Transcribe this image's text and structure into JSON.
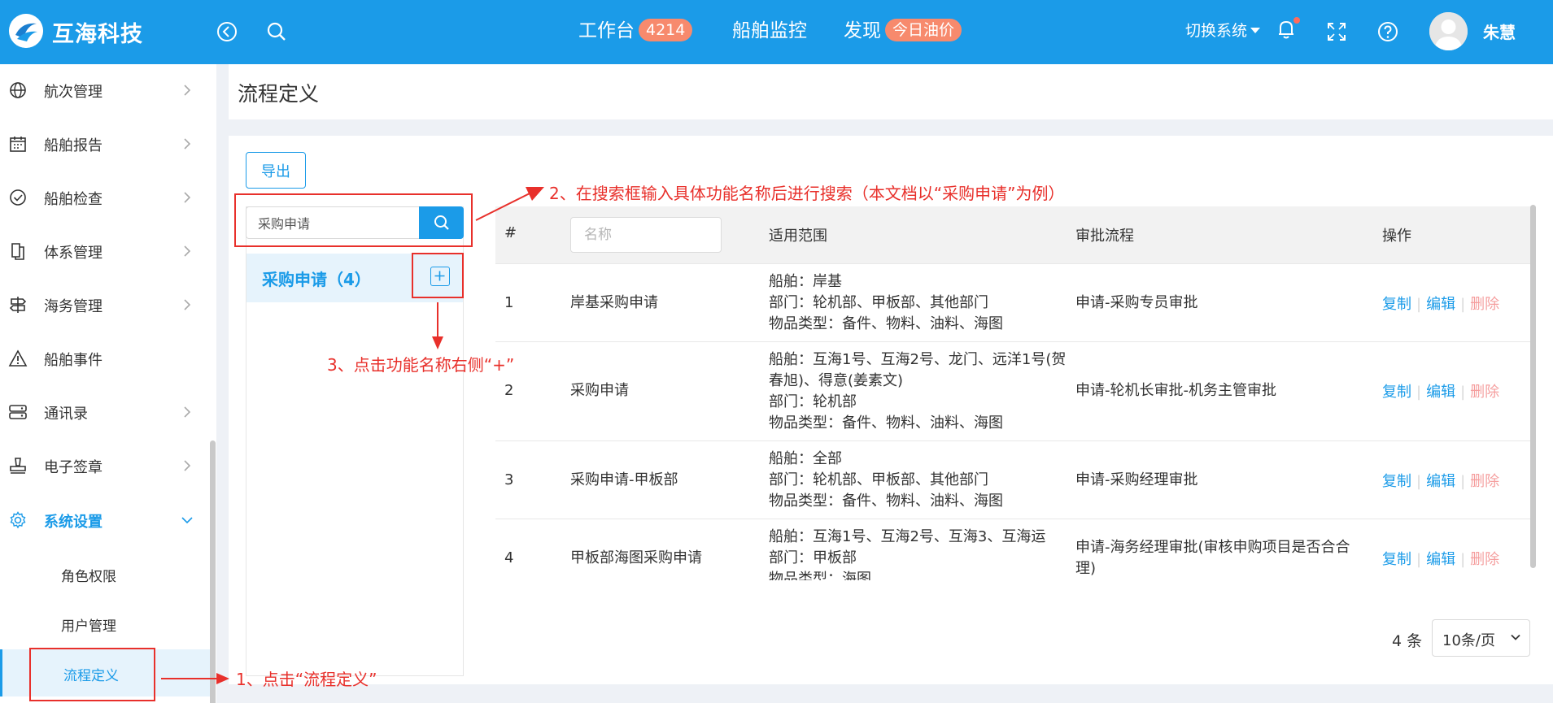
{
  "header": {
    "logo_text": "互海科技",
    "nav": [
      {
        "label": "工作台",
        "badge": "4214"
      },
      {
        "label": "船舶监控"
      },
      {
        "label": "发现",
        "badge": "今日油价"
      }
    ],
    "switch_system": "切换系统",
    "username": "朱慧",
    "colors": {
      "primary": "#1b9be8",
      "badge": "#f78a6d",
      "annotation": "#e8302b"
    }
  },
  "sidebar": {
    "items": [
      {
        "label": "航次管理",
        "icon": "globe-icon"
      },
      {
        "label": "船舶报告",
        "icon": "calendar-icon"
      },
      {
        "label": "船舶检查",
        "icon": "check-circle-icon"
      },
      {
        "label": "体系管理",
        "icon": "document-icon"
      },
      {
        "label": "海务管理",
        "icon": "signpost-icon"
      },
      {
        "label": "船舶事件",
        "icon": "warning-icon"
      },
      {
        "label": "通讯录",
        "icon": "server-icon"
      },
      {
        "label": "电子签章",
        "icon": "stamp-icon"
      },
      {
        "label": "系统设置",
        "icon": "gear-icon"
      }
    ],
    "sub_items": [
      "角色权限",
      "用户管理",
      "流程定义"
    ]
  },
  "page": {
    "title": "流程定义",
    "export_label": "导出",
    "search_value": "采购申请",
    "tree_node": "采购申请（4）"
  },
  "table": {
    "headers": {
      "index": "#",
      "name_placeholder": "名称",
      "scope": "适用范围",
      "flow": "审批流程",
      "ops": "操作"
    },
    "rows": [
      {
        "index": "1",
        "name": "岸基采购申请",
        "scope": [
          "船舶：岸基",
          "部门：轮机部、甲板部、其他部门",
          "物品类型：备件、物料、油料、海图"
        ],
        "flow": "申请-采购专员审批"
      },
      {
        "index": "2",
        "name": "采购申请",
        "scope": [
          "船舶：互海1号、互海2号、龙门、远洋1号(贺春旭)、得意(姜素文)",
          "部门：轮机部",
          "物品类型：备件、物料、油料、海图"
        ],
        "flow": "申请-轮机长审批-机务主管审批"
      },
      {
        "index": "3",
        "name": "采购申请-甲板部",
        "scope": [
          "船舶：全部",
          "部门：轮机部、甲板部、其他部门",
          "物品类型：备件、物料、油料、海图"
        ],
        "flow": "申请-采购经理审批"
      },
      {
        "index": "4",
        "name": "甲板部海图采购申请",
        "scope": [
          "船舶：互海1号、互海2号、互海3、互海运",
          "部门：甲板部",
          "物品类型：海图"
        ],
        "flow": "申请-海务经理审批(审核申购项目是否合合理)"
      }
    ],
    "op_copy": "复制",
    "op_edit": "编辑",
    "op_delete": "删除",
    "total": "4 条",
    "page_size": "10条/页"
  },
  "annotations": {
    "step1": "1、点击“流程定义”",
    "step2": "2、在搜索框输入具体功能名称后进行搜索（本文档以“采购申请”为例）",
    "step3": "3、点击功能名称右侧“+”"
  }
}
